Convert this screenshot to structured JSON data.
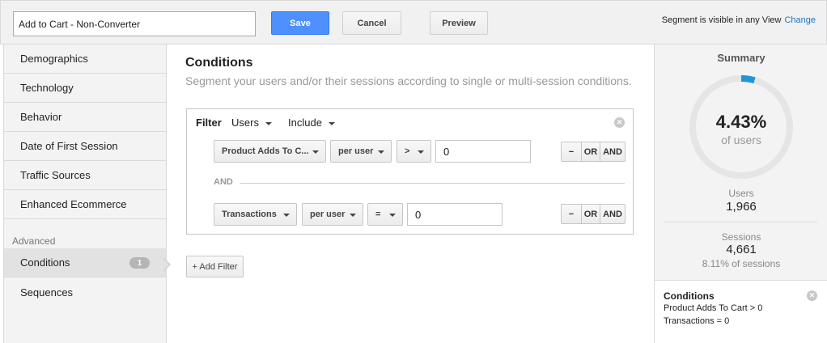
{
  "header": {
    "segment_name": "Add to Cart - Non-Converter",
    "save_label": "Save",
    "cancel_label": "Cancel",
    "preview_label": "Preview",
    "visibility_text": "Segment is visible in any View",
    "change_label": "Change"
  },
  "sidebar": {
    "items": [
      {
        "label": "Demographics"
      },
      {
        "label": "Technology"
      },
      {
        "label": "Behavior"
      },
      {
        "label": "Date of First Session"
      },
      {
        "label": "Traffic Sources"
      },
      {
        "label": "Enhanced Ecommerce"
      }
    ],
    "advanced_heading": "Advanced",
    "advanced_items": [
      {
        "label": "Conditions",
        "count": "1"
      },
      {
        "label": "Sequences"
      }
    ]
  },
  "main": {
    "title": "Conditions",
    "subtitle": "Segment your users and/or their sessions according to single or multi-session conditions.",
    "filter": {
      "label": "Filter",
      "scope": "Users",
      "mode": "Include",
      "rows": [
        {
          "metric": "Product Adds To C...",
          "per": "per user",
          "operator": ">",
          "value": "0"
        },
        {
          "metric": "Transactions",
          "per": "per user",
          "operator": "=",
          "value": "0"
        }
      ],
      "and_label": "AND",
      "logic": {
        "minus": "−",
        "or": "OR",
        "and": "AND"
      }
    },
    "add_filter_label": "+ Add Filter"
  },
  "summary": {
    "title": "Summary",
    "percent": "4.43%",
    "percent_value": 4.43,
    "percent_sub": "of users",
    "users_label": "Users",
    "users_value": "1,966",
    "sessions_label": "Sessions",
    "sessions_value": "4,661",
    "sessions_pct": "8.11% of sessions",
    "conditions_title": "Conditions",
    "conditions_lines": [
      "Product Adds To Cart > 0",
      "Transactions = 0"
    ]
  },
  "colors": {
    "accent": "#4d90fe",
    "ring_fill": "#2196d3",
    "ring_track": "#e5e5e5"
  }
}
